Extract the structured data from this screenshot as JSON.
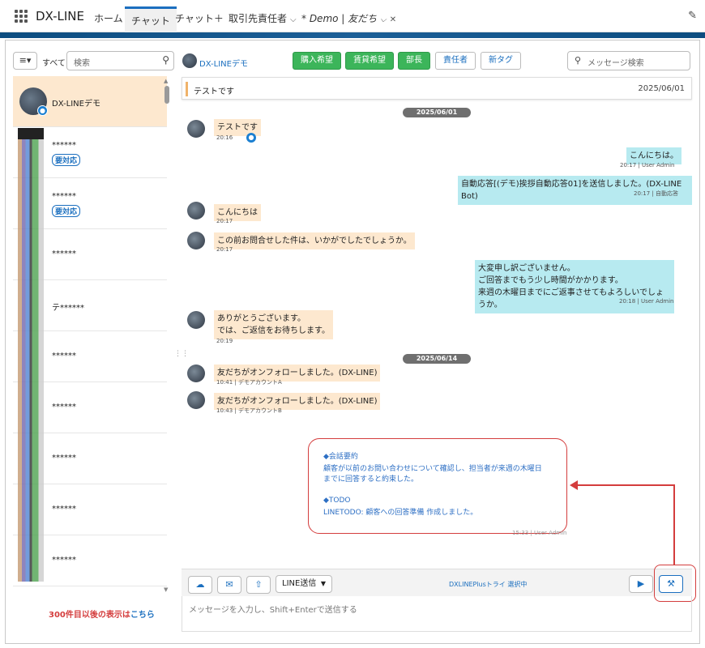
{
  "nav": {
    "app_name": "DX-LINE",
    "tabs": [
      {
        "label": "ホーム"
      },
      {
        "label": "チャット"
      },
      {
        "label": "チャット＋"
      },
      {
        "label": "取引先責任者"
      },
      {
        "label": "* Demo | 友だち"
      }
    ],
    "dropdown_icon": "chevron-down-icon",
    "close_icon": "close-icon",
    "edit_icon": "pencil-icon"
  },
  "sidebar": {
    "filter_label": "すべて",
    "search_placeholder": "検索",
    "contacts": [
      {
        "name": "DX-LINEデモ",
        "tag": ""
      },
      {
        "name": "******",
        "tag": "要対応"
      },
      {
        "name": "******",
        "tag": "要対応"
      },
      {
        "name": "******",
        "tag": ""
      },
      {
        "name": "テ******",
        "tag": ""
      },
      {
        "name": "******",
        "tag": ""
      },
      {
        "name": "******",
        "tag": ""
      },
      {
        "name": "******",
        "tag": ""
      },
      {
        "name": "******",
        "tag": ""
      },
      {
        "name": "******",
        "tag": ""
      }
    ],
    "more_text": "300件目以後の表示は",
    "more_link": "こちら"
  },
  "chat_header": {
    "name": "DX-LINEデモ",
    "tags": [
      {
        "label": "購入希望",
        "style": "green"
      },
      {
        "label": "賃貸希望",
        "style": "green"
      },
      {
        "label": "部長",
        "style": "green"
      },
      {
        "label": "責任者",
        "style": "white"
      },
      {
        "label": "新タグ",
        "style": "white"
      }
    ],
    "search_placeholder": "メッセージ検索"
  },
  "pinned": {
    "text": "テストです",
    "date": "2025/06/01"
  },
  "messages": {
    "date1": "2025/06/01",
    "m1": {
      "text": "テストです",
      "meta": "20:16"
    },
    "m2": {
      "text": "こんにちは。",
      "meta": "20:17 | User Admin"
    },
    "m3": {
      "text": "自動応答[(デモ)挨拶自動応答01]を送信しました。(DX-LINE Bot)",
      "meta": "20:17 | 自動応答"
    },
    "m4": {
      "text": "こんにちは",
      "meta": "20:17"
    },
    "m5": {
      "text": "この前お問合せした件は、いかがでしたでしょうか。",
      "meta": "20:17"
    },
    "m6": {
      "lines": [
        "大変申し訳ございません。",
        "ご回答までもう少し時間がかかります。",
        "来週の木曜日までにご返事させてもよろしいでしょうか。"
      ],
      "meta": "20:18 | User Admin"
    },
    "m7": {
      "lines": [
        "ありがとうございます。",
        "では、ご返信をお待ちします。"
      ],
      "meta": "20:19"
    },
    "date2": "2025/06/14",
    "m8": {
      "text": "友だちがオンフォローしました。(DX-LINE)",
      "meta": "10:41 | デモアカウントA"
    },
    "m9": {
      "text": "友だちがオンフォローしました。(DX-LINE)",
      "meta": "10:43 | デモアカウントB"
    }
  },
  "summary": {
    "heading1": "◆会話要約",
    "body1a": "顧客が以前のお問い合わせについて確認し、担当者が来週の木曜日",
    "body1b": "までに回答すると約束した。",
    "heading2": "◆TODO",
    "body2": "LINETODO: 顧客への回答準備 作成しました。",
    "meta": "15:33 | User Admin"
  },
  "composer": {
    "send_mode": "LINE送信",
    "status": "DXLINEPlusトライ 選択中",
    "placeholder": "メッセージを入力し、Shift+Enterで送信する"
  },
  "colors": {
    "accent": "#1b6fbf",
    "tag_green": "#3cb55a",
    "highlight_red": "#d43d3d",
    "incoming_bubble": "#fde8cf",
    "outgoing_bubble": "#b7eaf0"
  }
}
